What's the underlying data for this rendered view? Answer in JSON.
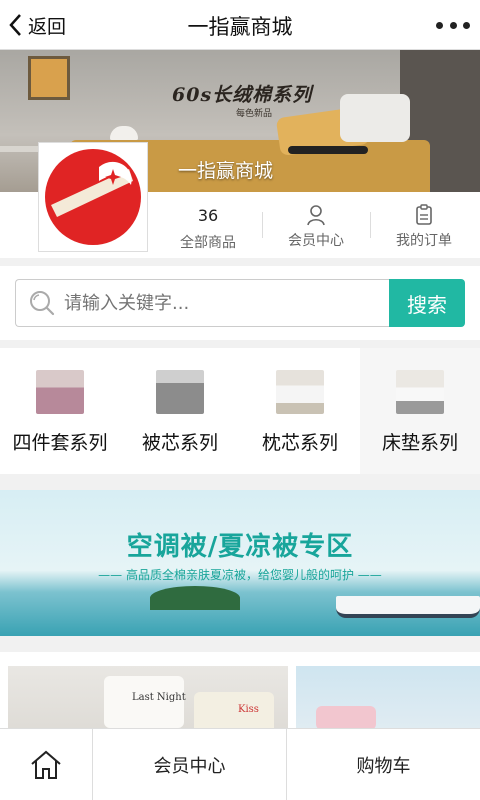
{
  "nav": {
    "back_label": "返回",
    "title": "一指赢商城"
  },
  "banner": {
    "headline": "60s长绒棉系列",
    "subline": "每色新品",
    "store_name": "一指赢商城"
  },
  "stats": {
    "products_count": "36",
    "products_label": "全部商品",
    "member_label": "会员中心",
    "orders_label": "我的订单"
  },
  "search": {
    "placeholder": "请输入关键字...",
    "button_label": "搜索"
  },
  "categories": [
    {
      "label": "四件套系列",
      "icon": "bedding-set-thumb"
    },
    {
      "label": "被芯系列",
      "icon": "duvet-thumb"
    },
    {
      "label": "枕芯系列",
      "icon": "pillow-thumb"
    },
    {
      "label": "床垫系列",
      "icon": "mattress-thumb"
    }
  ],
  "promo": {
    "title": "空调被/夏凉被专区",
    "subtitle": "—— 高品质全棉亲肤夏凉被，给您婴儿般的呵护 ——"
  },
  "products": [
    {
      "pillow_text": "Last Night",
      "pillow_text2": "Kiss"
    }
  ],
  "tabbar": {
    "home_icon": "home-icon",
    "member_label": "会员中心",
    "cart_label": "购物车"
  },
  "colors": {
    "accent": "#21b8a3",
    "promo_title": "#18a59b",
    "logo_red": "#e02424"
  }
}
